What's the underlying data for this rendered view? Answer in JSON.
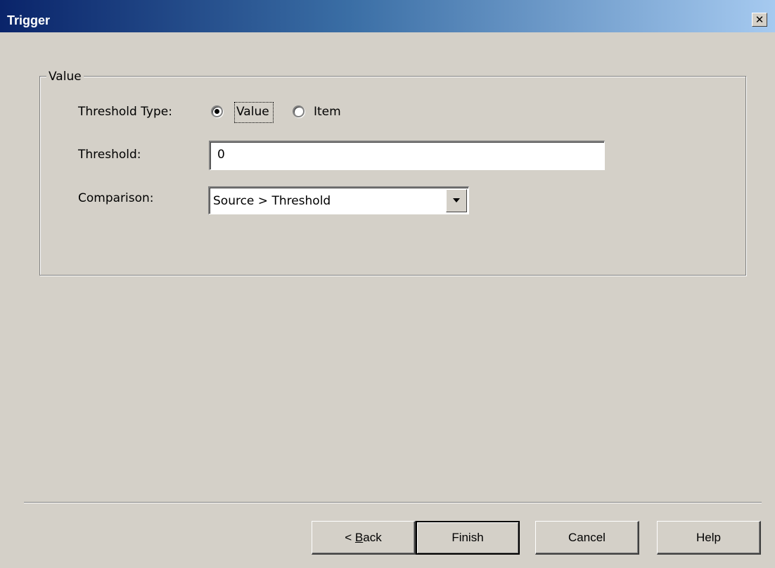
{
  "window": {
    "title": "Trigger",
    "close_glyph": "✕"
  },
  "group": {
    "legend": "Value"
  },
  "threshold_type": {
    "label": "Threshold Type:",
    "options": [
      {
        "label": "Value",
        "selected": true
      },
      {
        "label": "Item",
        "selected": false
      }
    ]
  },
  "threshold": {
    "label": "Threshold:",
    "value": "0"
  },
  "comparison": {
    "label": "Comparison:",
    "selected": "Source > Threshold"
  },
  "buttons": {
    "back_prefix": "< ",
    "back_mnemonic": "B",
    "back_rest": "ack",
    "finish": "Finish",
    "cancel": "Cancel",
    "help": "Help"
  }
}
